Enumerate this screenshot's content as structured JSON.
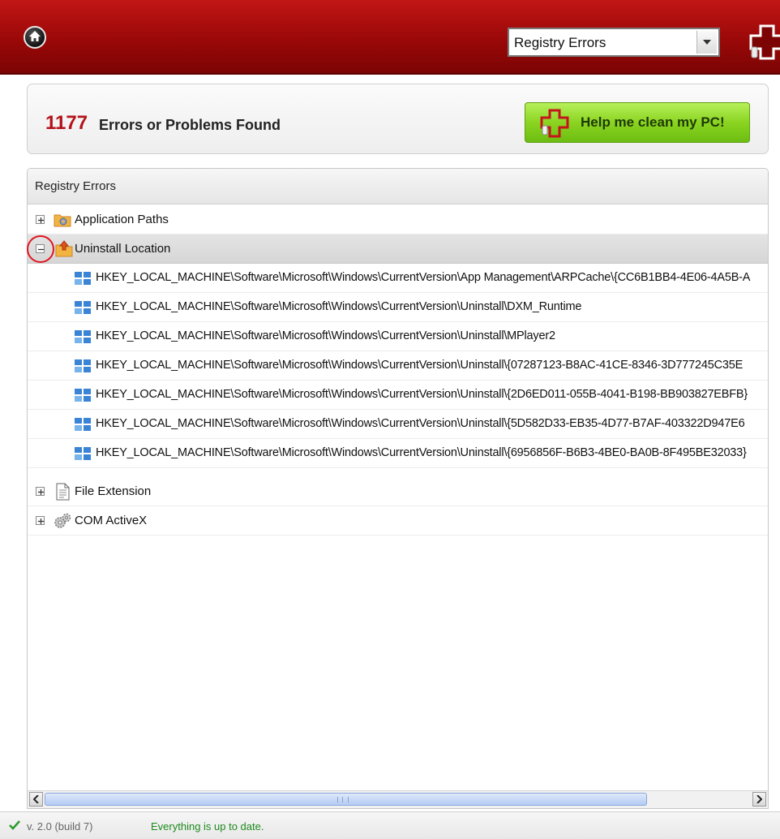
{
  "toolbar": {
    "category_select_value": "Registry Errors",
    "icons": [
      "home-icon",
      "chevron-down-icon",
      "cross-logo-icon"
    ]
  },
  "summary": {
    "error_count": "1177",
    "error_label": "Errors or Problems Found",
    "clean_button_label": "Help me clean my PC!"
  },
  "tree": {
    "header": "Registry Errors",
    "nodes": [
      {
        "label": "Application Paths",
        "icon": "folder-gear-icon",
        "expanded": false
      },
      {
        "label": "Uninstall Location",
        "icon": "folder-up-icon",
        "expanded": true,
        "children": [
          "HKEY_LOCAL_MACHINE\\Software\\Microsoft\\Windows\\CurrentVersion\\App Management\\ARPCache\\{CC6B1BB4-4E06-4A5B-A",
          "HKEY_LOCAL_MACHINE\\Software\\Microsoft\\Windows\\CurrentVersion\\Uninstall\\DXM_Runtime",
          "HKEY_LOCAL_MACHINE\\Software\\Microsoft\\Windows\\CurrentVersion\\Uninstall\\MPlayer2",
          "HKEY_LOCAL_MACHINE\\Software\\Microsoft\\Windows\\CurrentVersion\\Uninstall\\{07287123-B8AC-41CE-8346-3D777245C35E",
          "HKEY_LOCAL_MACHINE\\Software\\Microsoft\\Windows\\CurrentVersion\\Uninstall\\{2D6ED011-055B-4041-B198-BB903827EBFB}",
          "HKEY_LOCAL_MACHINE\\Software\\Microsoft\\Windows\\CurrentVersion\\Uninstall\\{5D582D33-EB35-4D77-B7AF-403322D947E6",
          "HKEY_LOCAL_MACHINE\\Software\\Microsoft\\Windows\\CurrentVersion\\Uninstall\\{6956856F-B6B3-4BE0-BA0B-8F495BE32033}"
        ]
      },
      {
        "label": "File Extension",
        "icon": "document-icon",
        "expanded": false
      },
      {
        "label": "COM ActiveX",
        "icon": "gears-icon",
        "expanded": false
      }
    ]
  },
  "scrollbar": {
    "grip_text": "III"
  },
  "status": {
    "version": "v. 2.0 (build 7)",
    "message": "Everything is up to date.",
    "colors": {
      "accent": "#9a0808",
      "ok": "#1e8a1e"
    }
  }
}
